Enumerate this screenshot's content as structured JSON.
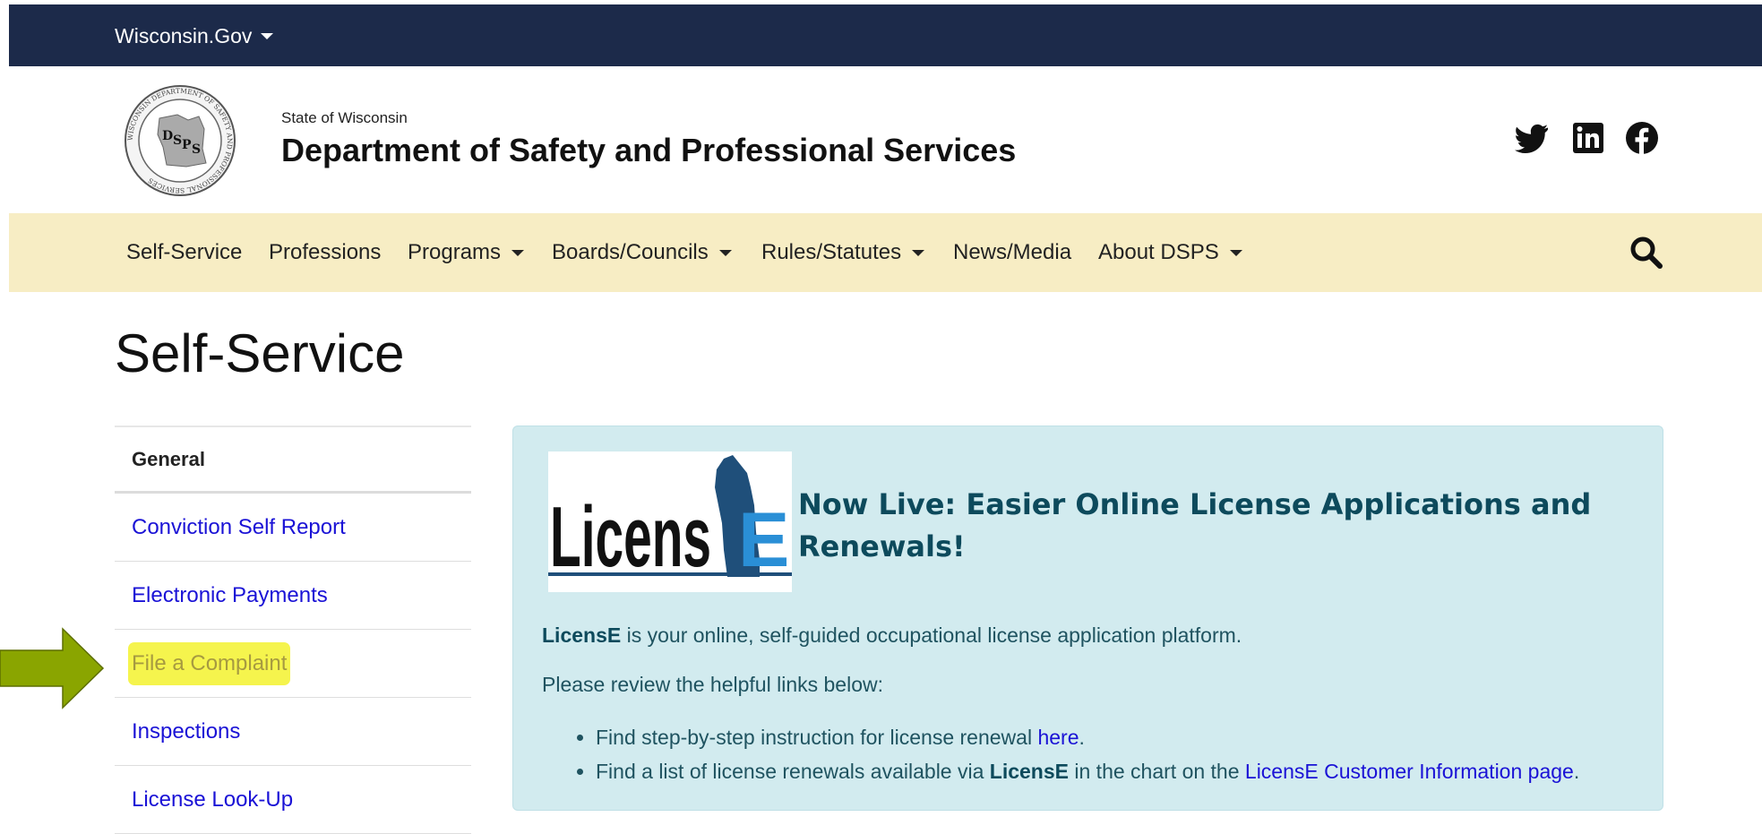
{
  "topbar": {
    "gov_label": "Wisconsin.Gov"
  },
  "header": {
    "state_name": "State of Wisconsin",
    "dept_name": "Department of Safety and Professional Services",
    "seal_text": "WISCONSIN DEPARTMENT OF SAFETY AND PROFESSIONAL SERVICES",
    "seal_letters": [
      "D",
      "S",
      "P",
      "S"
    ]
  },
  "social": [
    "twitter-icon",
    "linkedin-icon",
    "facebook-icon"
  ],
  "nav": {
    "items": [
      {
        "label": "Self-Service",
        "dropdown": false
      },
      {
        "label": "Professions",
        "dropdown": false
      },
      {
        "label": "Programs",
        "dropdown": true
      },
      {
        "label": "Boards/Councils",
        "dropdown": true
      },
      {
        "label": "Rules/Statutes",
        "dropdown": true
      },
      {
        "label": "News/Media",
        "dropdown": false
      },
      {
        "label": "About DSPS",
        "dropdown": true
      }
    ]
  },
  "page": {
    "title": "Self-Service"
  },
  "sidebar": {
    "heading": "General",
    "items": [
      {
        "label": "Conviction Self Report"
      },
      {
        "label": "Electronic Payments"
      },
      {
        "label": "File a Complaint",
        "highlighted": true
      },
      {
        "label": "Inspections"
      },
      {
        "label": "License Look-Up"
      }
    ]
  },
  "card": {
    "logo_text": "Licens",
    "logo_letter": "E",
    "heading": "Now Live: Easier Online License Applications and Renewals!",
    "p1_bold": "LicensE",
    "p1_rest": " is your online, self-guided occupational license application platform.",
    "p2": "Please review the helpful links below:",
    "list": [
      {
        "pre": "Find step-by-step instruction for license renewal ",
        "link": "here",
        "post": "."
      },
      {
        "pre": "Find a list of license renewals available via ",
        "bold": "LicensE",
        "mid": " in the chart on the ",
        "link": "LicensE Customer Information page",
        "post": "."
      }
    ]
  },
  "colors": {
    "topbar": "#1c2a4a",
    "navbar": "#f7edc4",
    "card_bg": "#d2ebef",
    "link": "#1a12d6",
    "highlight": "#f5f44d",
    "arrow": "#8aa500"
  }
}
